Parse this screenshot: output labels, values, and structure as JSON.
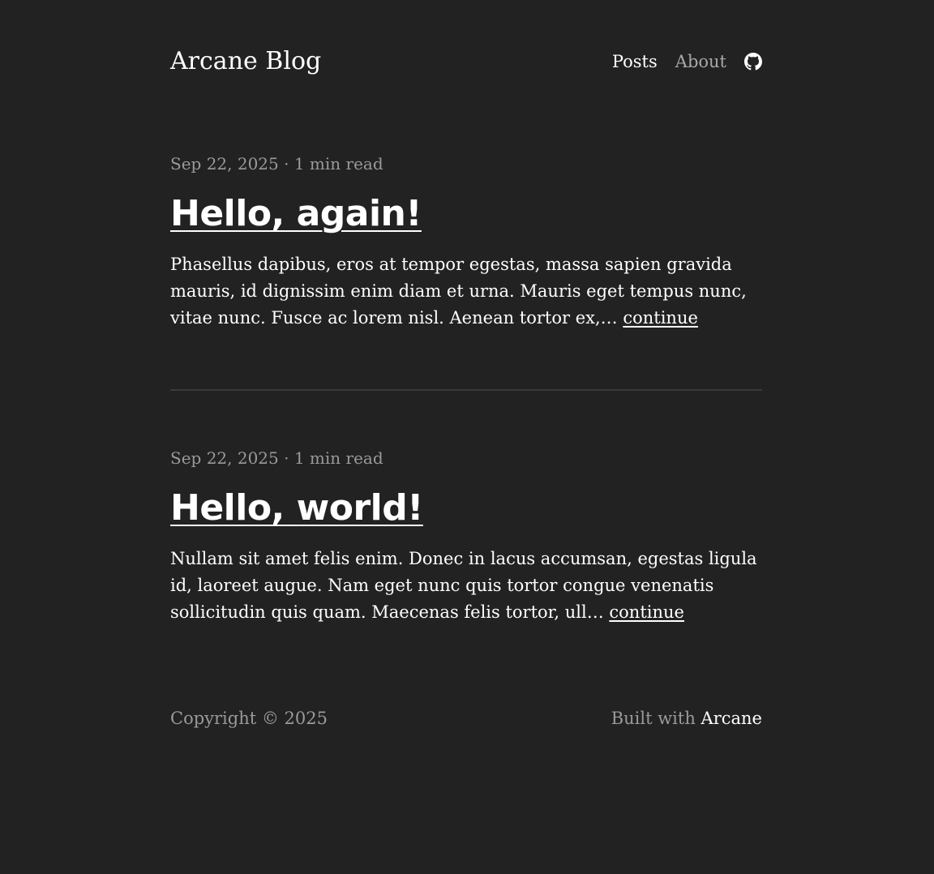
{
  "header": {
    "site_title": "Arcane Blog",
    "nav": {
      "posts": "Posts",
      "about": "About",
      "github_icon": "github-icon"
    }
  },
  "posts": [
    {
      "meta": "Sep 22, 2025 · 1 min read",
      "title": "Hello, again!",
      "excerpt": "Phasellus dapibus, eros at tempor egestas, massa sapien gravida mauris, id dignissim enim diam et urna. Mauris eget tempus nunc, vitae nunc. Fusce ac lorem nisl. Aenean tortor ex,… ",
      "continue": "continue"
    },
    {
      "meta": "Sep 22, 2025 · 1 min read",
      "title": "Hello, world!",
      "excerpt": "Nullam sit amet felis enim. Donec in lacus accumsan, egestas ligula id, laoreet augue. Nam eget nunc quis tortor congue venenatis sollicitudin quis quam. Maecenas felis tortor, ull… ",
      "continue": "continue"
    }
  ],
  "footer": {
    "copyright": "Copyright © 2025",
    "built_with": "Built with ",
    "built_link": "Arcane"
  },
  "colors": {
    "background": "#222222",
    "text": "#ffffff",
    "muted": "#9a9a9a",
    "divider": "#3a3a3a"
  }
}
